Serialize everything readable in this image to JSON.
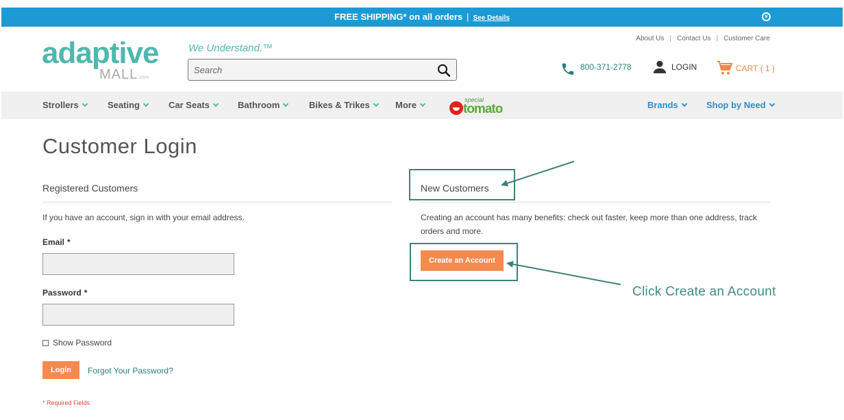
{
  "promo": {
    "text": "FREE SHIPPING* on all orders",
    "separator": "|",
    "details_link": "See Details",
    "close_icon": "close-circle-icon"
  },
  "header": {
    "logo_word": "adaptive",
    "logo_mall": "MALL",
    "logo_com": ".com",
    "tagline": "We Understand.™",
    "search_placeholder": "Search",
    "search_icon": "search-icon",
    "top_links": [
      "About Us",
      "Contact Us",
      "Customer Care"
    ],
    "phone": "800-371-2778",
    "login": "LOGIN",
    "cart": "CART ( 1 )"
  },
  "nav": {
    "items": [
      "Strollers",
      "Seating",
      "Car Seats",
      "Bathroom",
      "Bikes & Trikes",
      "More"
    ],
    "brand_logo_small": "special",
    "brand_logo": "tomato",
    "right_items": [
      "Brands",
      "Shop by Need"
    ]
  },
  "page": {
    "title": "Customer Login",
    "registered": {
      "heading": "Registered Customers",
      "intro": "If you have an account, sign in with your email address.",
      "email_label": "Email",
      "password_label": "Password",
      "required_mark": "*",
      "show_password": "Show Password",
      "login_button": "Login",
      "forgot": "Forgot Your Password?",
      "required_fields": "* Required Fields"
    },
    "new_customers": {
      "heading": "New Customers",
      "intro": "Creating an account has many benefits: check out faster, keep more than one address, track orders and more.",
      "create_button": "Create an Account"
    }
  },
  "annotation": {
    "instruction": "Click Create an Account",
    "color": "#3f7f78"
  },
  "colors": {
    "promo_bg": "#1b9ad6",
    "brand_teal": "#4fb8ad",
    "accent_orange": "#f58a4f",
    "link_blue": "#2f8fd0"
  }
}
